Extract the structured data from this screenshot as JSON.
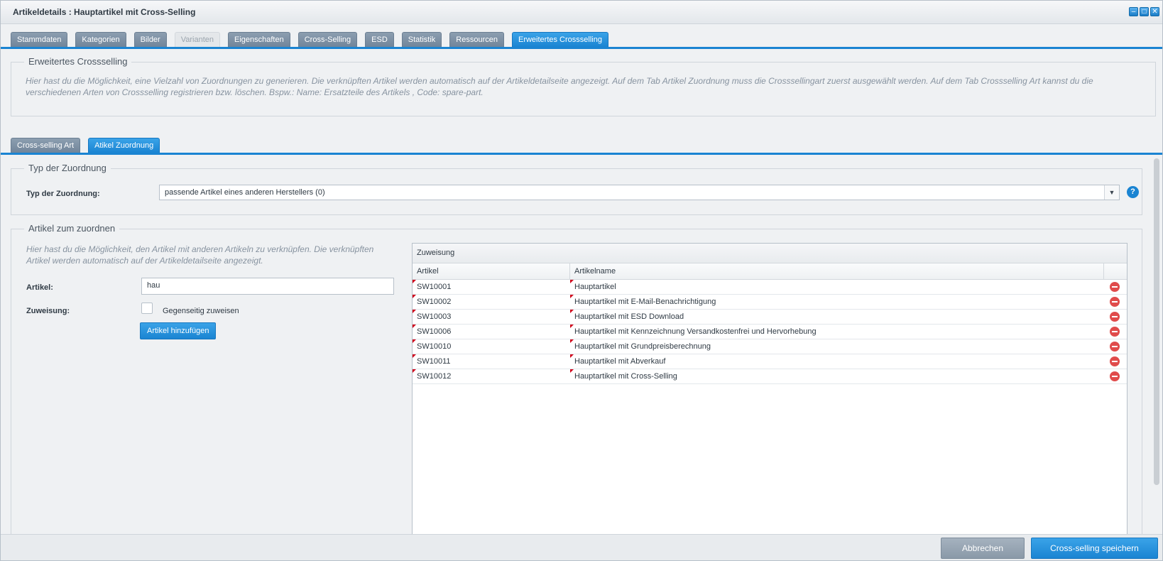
{
  "window": {
    "title": "Artikeldetails : Hauptartikel mit Cross-Selling"
  },
  "main_tabs": [
    {
      "label": "Stammdaten"
    },
    {
      "label": "Kategorien"
    },
    {
      "label": "Bilder"
    },
    {
      "label": "Varianten"
    },
    {
      "label": "Eigenschaften"
    },
    {
      "label": "Cross-Selling"
    },
    {
      "label": "ESD"
    },
    {
      "label": "Statistik"
    },
    {
      "label": "Ressourcen"
    },
    {
      "label": "Erweitertes Crossselling"
    }
  ],
  "intro": {
    "legend": "Erweitertes Crossselling",
    "text": "Hier hast du die Möglichkeit, eine Vielzahl von Zuordnungen zu generieren. Die verknüpften Artikel werden automatisch auf der Artikeldetailseite angezeigt. Auf dem Tab Artikel Zuordnung muss die Crosssellingart zuerst ausgewählt werden. Auf dem Tab Crossselling Art kannst du die verschiedenen Arten von Crossselling registrieren bzw. löschen. Bspw.: Name: Ersatzteile des Artikels , Code: spare-part."
  },
  "sub_tabs": [
    {
      "label": "Cross-selling Art"
    },
    {
      "label": "Atikel Zuordnung"
    }
  ],
  "typ": {
    "legend": "Typ der Zuordnung",
    "label": "Typ der Zuordnung:",
    "value": "passende Artikel eines anderen Herstellers  (0)",
    "help": "?"
  },
  "artikel_section": {
    "legend": "Artikel zum zuordnen",
    "description": "Hier hast du die Möglichkeit, den Artikel mit anderen Artikeln zu verknüpfen. Die verknüpften Artikel werden automatisch auf der Artikeldetailseite angezeigt.",
    "artikel_label": "Artikel:",
    "artikel_value": "hau",
    "zuweisung_label": "Zuweisung:",
    "checkbox_label": "Gegenseitig zuweisen",
    "add_button": "Artikel hinzufügen"
  },
  "grid": {
    "title": "Zuweisung",
    "columns": [
      "Artikel",
      "Artikelname"
    ],
    "rows": [
      {
        "nr": "SW10001",
        "name": "Hauptartikel"
      },
      {
        "nr": "SW10002",
        "name": "Hauptartikel mit E-Mail-Benachrichtigung"
      },
      {
        "nr": "SW10003",
        "name": "Hauptartikel mit ESD Download"
      },
      {
        "nr": "SW10006",
        "name": "Hauptartikel mit Kennzeichnung Versandkostenfrei und Hervorhebung"
      },
      {
        "nr": "SW10010",
        "name": "Hauptartikel mit Grundpreisberechnung"
      },
      {
        "nr": "SW10011",
        "name": "Hauptartikel mit Abverkauf"
      },
      {
        "nr": "SW10012",
        "name": "Hauptartikel mit Cross-Selling"
      }
    ]
  },
  "footer": {
    "cancel": "Abbrechen",
    "save": "Cross-selling speichern"
  },
  "colors": {
    "accent": "#1a84d2",
    "tab_inactive": "#71859a",
    "delete": "#e04b4b"
  }
}
